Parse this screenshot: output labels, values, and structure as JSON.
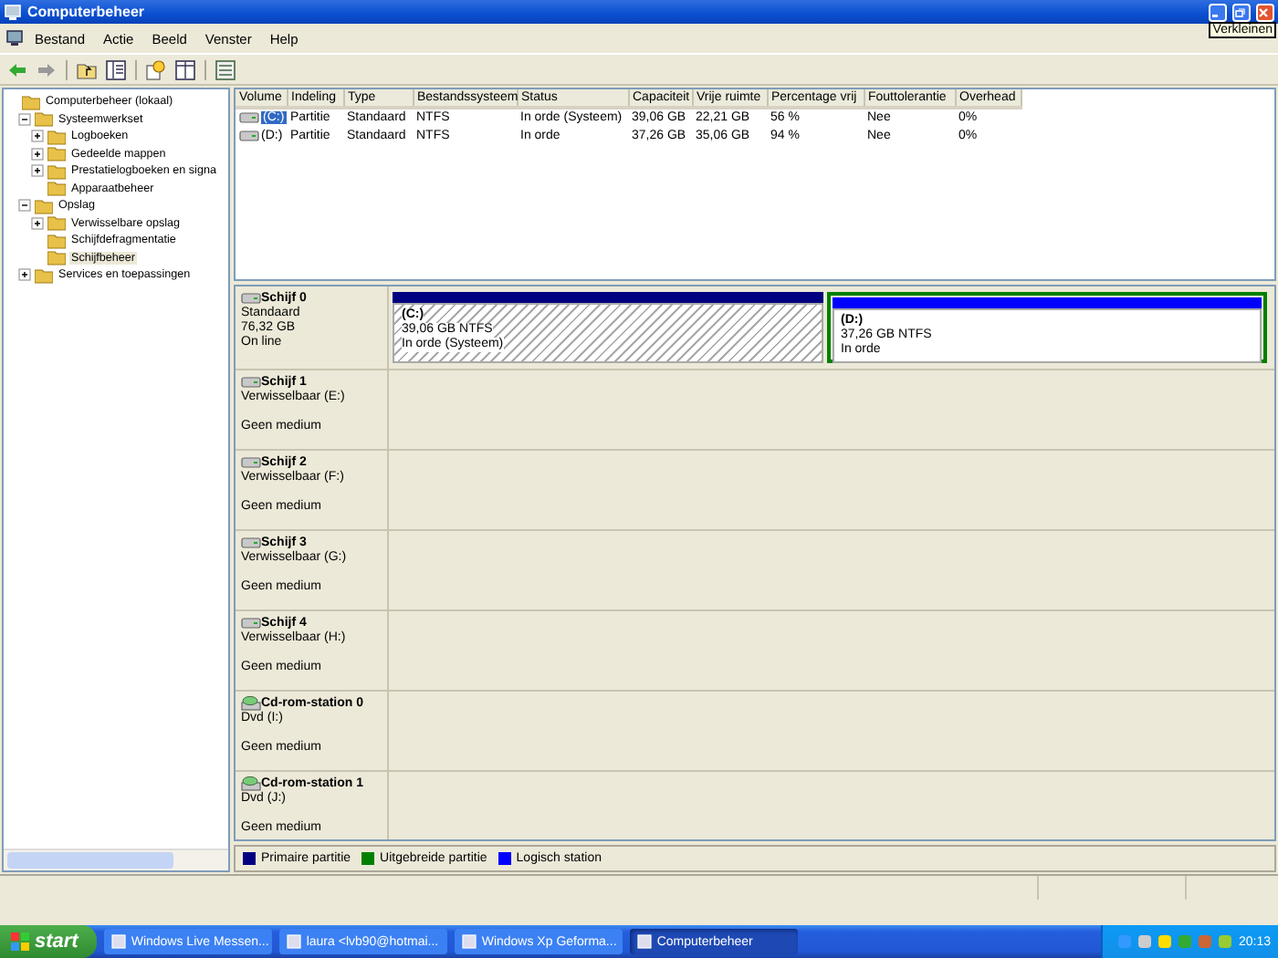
{
  "window": {
    "title": "Computerbeheer",
    "tooltip": "Verkleinen"
  },
  "menu": [
    "Bestand",
    "Actie",
    "Beeld",
    "Venster",
    "Help"
  ],
  "tree": [
    {
      "label": "Computerbeheer (lokaal)",
      "selected": false,
      "children": [
        {
          "label": "Systeemwerkset",
          "expanded": true,
          "selected": false,
          "children": [
            {
              "label": "Logboeken",
              "expanded": false,
              "selected": false
            },
            {
              "label": "Gedeelde mappen",
              "expanded": false,
              "selected": false
            },
            {
              "label": "Prestatielogboeken en signa",
              "expanded": false,
              "selected": false
            },
            {
              "label": "Apparaatbeheer",
              "selected": false
            }
          ]
        },
        {
          "label": "Opslag",
          "expanded": true,
          "selected": false,
          "children": [
            {
              "label": "Verwisselbare opslag",
              "expanded": false,
              "selected": false
            },
            {
              "label": "Schijfdefragmentatie",
              "selected": false
            },
            {
              "label": "Schijfbeheer",
              "selected": true
            }
          ]
        },
        {
          "label": "Services en toepassingen",
          "expanded": false,
          "selected": false
        }
      ]
    }
  ],
  "volumes": {
    "columns": [
      "Volume",
      "Indeling",
      "Type",
      "Bestandssysteem",
      "Status",
      "Capaciteit",
      "Vrije ruimte",
      "Percentage vrij",
      "Fouttolerantie",
      "Overhead"
    ],
    "rows": [
      {
        "selected": true,
        "cells": [
          "(C:)",
          "Partitie",
          "Standaard",
          "NTFS",
          "In orde (Systeem)",
          "39,06 GB",
          "22,21 GB",
          "56 %",
          "Nee",
          "0%"
        ]
      },
      {
        "selected": false,
        "cells": [
          "(D:)",
          "Partitie",
          "Standaard",
          "NTFS",
          "In orde",
          "37,26 GB",
          "35,06 GB",
          "94 %",
          "Nee",
          "0%"
        ]
      }
    ]
  },
  "disks": [
    {
      "kind": "disk",
      "name": "Schijf 0",
      "type": "Standaard",
      "size": "76,32 GB",
      "status": "On line",
      "partitions": [
        {
          "kind": "primary",
          "selected": true,
          "label": "(C:)",
          "size": "39,06 GB NTFS",
          "status": "In orde (Systeem)"
        },
        {
          "kind": "logical",
          "selected": false,
          "label": "(D:)",
          "size": "37,26 GB NTFS",
          "status": "In orde"
        }
      ]
    },
    {
      "kind": "disk",
      "name": "Schijf 1",
      "type": "Verwisselbaar (E:)",
      "status": "Geen medium"
    },
    {
      "kind": "disk",
      "name": "Schijf 2",
      "type": "Verwisselbaar (F:)",
      "status": "Geen medium"
    },
    {
      "kind": "disk",
      "name": "Schijf 3",
      "type": "Verwisselbaar (G:)",
      "status": "Geen medium"
    },
    {
      "kind": "disk",
      "name": "Schijf 4",
      "type": "Verwisselbaar (H:)",
      "status": "Geen medium"
    },
    {
      "kind": "cdrom",
      "name": "Cd-rom-station 0",
      "type": "Dvd (I:)",
      "status": "Geen medium"
    },
    {
      "kind": "cdrom",
      "name": "Cd-rom-station 1",
      "type": "Dvd (J:)",
      "status": "Geen medium"
    }
  ],
  "legend": [
    {
      "label": "Primaire partitie",
      "color": "#000080"
    },
    {
      "label": "Uitgebreide partitie",
      "color": "#008000"
    },
    {
      "label": "Logisch station",
      "color": "#0000ff"
    }
  ],
  "taskbar": {
    "start": "start",
    "buttons": [
      {
        "label": "Windows Live Messen...",
        "selected": false
      },
      {
        "label": "laura <lvb90@hotmai...",
        "selected": false
      },
      {
        "label": "Windows Xp Geforma...",
        "selected": false
      },
      {
        "label": "Computerbeheer",
        "selected": true
      }
    ],
    "clock": "20:13"
  }
}
